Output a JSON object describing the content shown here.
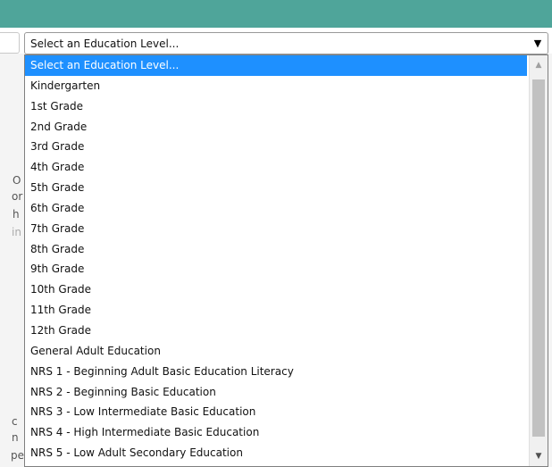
{
  "select": {
    "value": "Select an Education Level...",
    "arrow_icon": "triangle-down-icon"
  },
  "background_fragments": [
    "O",
    "or",
    "h",
    "in",
    "c",
    "n",
    "pe"
  ],
  "options": [
    "Select an Education Level...",
    "Kindergarten",
    "1st Grade",
    "2nd Grade",
    "3rd Grade",
    "4th Grade",
    "5th Grade",
    "6th Grade",
    "7th Grade",
    "8th Grade",
    "9th Grade",
    "10th Grade",
    "11th Grade",
    "12th Grade",
    "General Adult Education",
    "NRS 1 - Beginning Adult Basic Education Literacy",
    "NRS 2 - Beginning Basic Education",
    "NRS 3 - Low Intermediate Basic Education",
    "NRS 4 - High Intermediate Basic Education",
    "NRS 5 - Low Adult Secondary Education"
  ],
  "selected_index": 0,
  "colors": {
    "header": "#4fa59a",
    "highlight": "#1e90ff"
  }
}
